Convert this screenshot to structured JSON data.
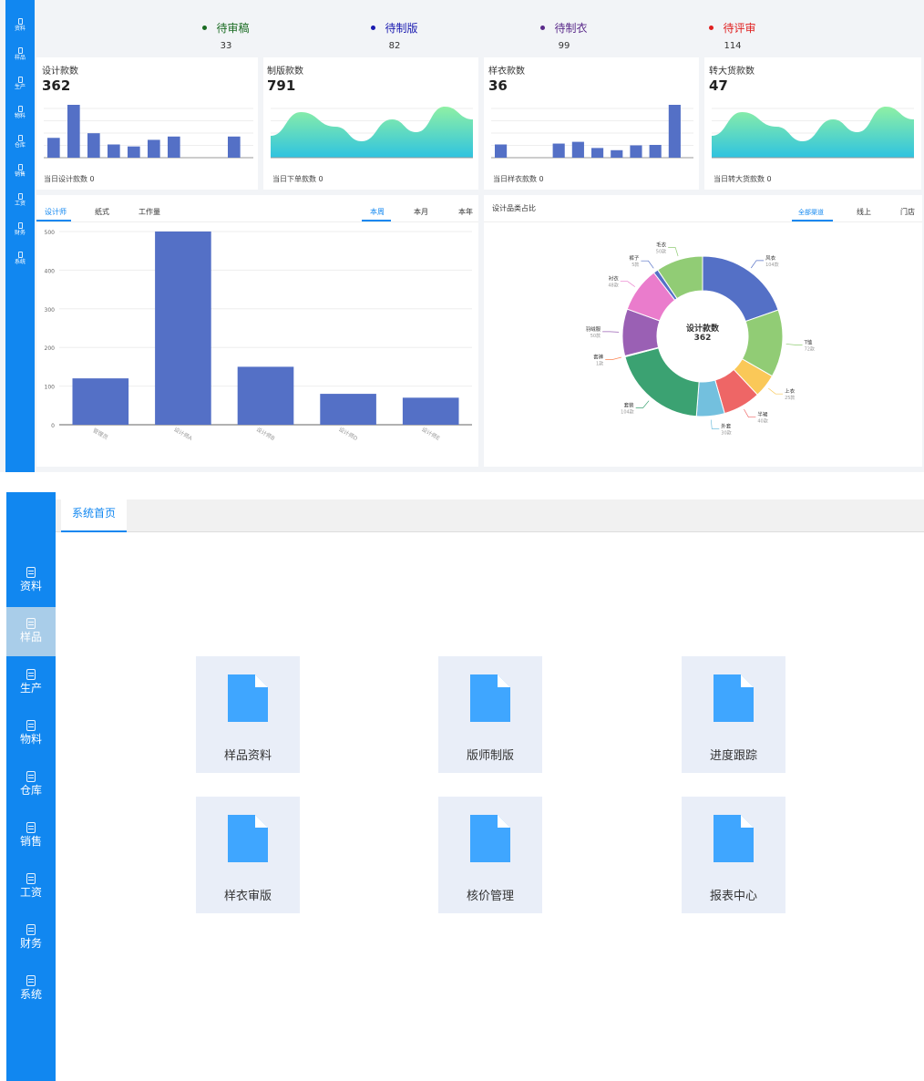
{
  "top_sidebar": {
    "items": [
      "资料",
      "样品",
      "生产",
      "物料",
      "仓库",
      "销售",
      "工资",
      "财务",
      "系统"
    ]
  },
  "status": [
    {
      "label": "待审稿",
      "count": "33",
      "color": "#1a6b22"
    },
    {
      "label": "待制版",
      "count": "82",
      "color": "#1a1ab0"
    },
    {
      "label": "待制衣",
      "count": "99",
      "color": "#5a2a8a"
    },
    {
      "label": "待评审",
      "count": "114",
      "color": "#e02020"
    }
  ],
  "cards": [
    {
      "title": "设计款数",
      "value": "362",
      "footer": "当日设计款数  0",
      "kind": "bars",
      "values": [
        3,
        8,
        3.7,
        2,
        1.7,
        2.7,
        3.2,
        0,
        0,
        3.2
      ]
    },
    {
      "title": "制版款数",
      "value": "791",
      "footer": "当日下单款数  0",
      "kind": "area"
    },
    {
      "title": "样衣款数",
      "value": "36",
      "footer": "当日样衣款数  0",
      "kind": "bars",
      "values": [
        3,
        0,
        0,
        3.2,
        3.6,
        2.2,
        1.7,
        2.8,
        2.9,
        12
      ]
    },
    {
      "title": "转大货款数",
      "value": "47",
      "footer": "当日转大货款数  0",
      "kind": "area"
    }
  ],
  "left_panel": {
    "tabs": [
      "设计师",
      "纸式",
      "工作量"
    ],
    "period_tabs": [
      "本周",
      "本月",
      "本年"
    ],
    "chart_data": {
      "type": "bar",
      "categories": [
        "管理员",
        "设计师A",
        "设计师B",
        "设计师D",
        "设计师E"
      ],
      "values": [
        120,
        500,
        150,
        80,
        70
      ],
      "ylim": [
        0,
        500
      ],
      "yticks": [
        "0",
        "100",
        "200",
        "300",
        "400",
        "500"
      ],
      "color": "#5470c6"
    }
  },
  "right_panel": {
    "title": "设计品类占比",
    "tabs": [
      "全部渠道",
      "线上",
      "门店"
    ],
    "center_label": "设计款数",
    "center_value": "362",
    "chart_data": {
      "type": "pie",
      "slices": [
        {
          "name": "风衣",
          "value": 104,
          "label": "104款",
          "color": "#5470c6"
        },
        {
          "name": "T恤",
          "value": 72,
          "label": "72款",
          "color": "#91cc75"
        },
        {
          "name": "上衣",
          "value": 25,
          "label": "25款",
          "color": "#fac858"
        },
        {
          "name": "半裙",
          "value": 40,
          "label": "40款",
          "color": "#ee6666"
        },
        {
          "name": "外套",
          "value": 30,
          "label": "30款",
          "color": "#73c0de"
        },
        {
          "name": "套装",
          "value": 104,
          "label": "104款",
          "color": "#3ba272"
        },
        {
          "name": "套裤",
          "value": 1,
          "label": "1款",
          "color": "#fc8452"
        },
        {
          "name": "羽绒服",
          "value": 50,
          "label": "50款",
          "color": "#9a60b4"
        },
        {
          "name": "衬衣",
          "value": 48,
          "label": "48款",
          "color": "#ea7ccc"
        },
        {
          "name": "裤子",
          "value": 5,
          "label": "5款",
          "color": "#5470c6"
        },
        {
          "name": "毛衣",
          "value": 50,
          "label": "50款",
          "color": "#91cc75"
        }
      ]
    }
  },
  "app": {
    "home_tab": "系统首页",
    "nav": [
      "资料",
      "样品",
      "生产",
      "物料",
      "仓库",
      "销售",
      "工资",
      "财务",
      "系统"
    ],
    "active_nav": "样品",
    "tiles": [
      "样品资料",
      "版师制版",
      "进度跟踪",
      "样衣审版",
      "核价管理",
      "报表中心"
    ]
  }
}
